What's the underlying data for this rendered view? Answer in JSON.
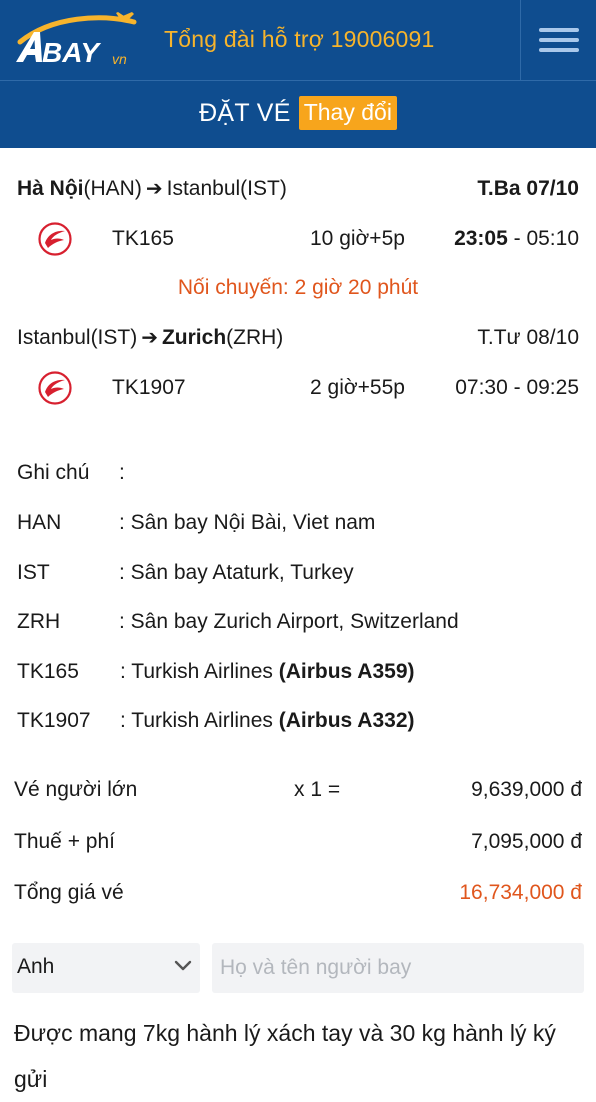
{
  "header": {
    "logo_text": "BAY",
    "logo_suffix": "vn",
    "hotline": "Tổng đài hỗ trợ 19006091",
    "menu_icon": "hamburger-menu-icon"
  },
  "subheader": {
    "title": "ĐẶT VÉ",
    "change_label": "Thay đổi"
  },
  "segments": [
    {
      "from_city": "Hà Nội",
      "from_code": "(HAN)",
      "to_city": "Istanbul",
      "to_code": "(IST)",
      "date": "T.Ba 07/10",
      "flight": "TK165",
      "duration": "10 giờ+5p",
      "depart": "23:05",
      "arrive": " - 05:10"
    },
    {
      "from_city": "Istanbul",
      "from_code": "(IST)",
      "to_city": "Zurich",
      "to_code": "(ZRH)",
      "date": "T.Tư 08/10",
      "flight": "TK1907",
      "duration": "2 giờ+55p",
      "depart": "07:30",
      "arrive": " - 09:25"
    }
  ],
  "transfer_text": "Nối chuyến: 2 giờ 20 phút",
  "notes": {
    "title": "Ghi chú",
    "title_sep": ":",
    "airports": [
      {
        "code": "HAN",
        "desc": ": Sân bay Nội Bài, Viet nam"
      },
      {
        "code": "IST",
        "desc": ": Sân bay Ataturk, Turkey"
      },
      {
        "code": "ZRH",
        "desc": ": Sân bay Zurich Airport, Switzerland"
      }
    ],
    "flights": [
      {
        "code": "TK165",
        "airline": ":  Turkish Airlines ",
        "aircraft": "(Airbus A359)"
      },
      {
        "code": "TK1907",
        "airline": ":  Turkish Airlines ",
        "aircraft": "(Airbus A332)"
      }
    ]
  },
  "prices": {
    "adult_label": "Vé người lớn",
    "adult_mult": "x 1 =",
    "adult_amount": "9,639,000 đ",
    "tax_label": "Thuế + phí",
    "tax_amount": "7,095,000 đ",
    "total_label": "Tổng giá vé",
    "total_amount": "16,734,000 đ"
  },
  "form": {
    "title_selected": "Anh",
    "name_placeholder": "Họ và tên người bay",
    "name_value": ""
  },
  "baggage_text": "Được mang 7kg hành lý xách tay và 30 kg hành lý ký gửi",
  "colors": {
    "header_blue": "#0f4d8f",
    "accent_orange": "#f7a51c",
    "price_red": "#e0561d"
  }
}
